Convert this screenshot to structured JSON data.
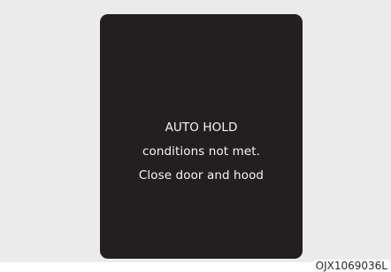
{
  "display": {
    "lines": [
      "AUTO HOLD",
      "conditions not met.",
      "Close door and hood"
    ]
  },
  "figure_code": "OJX1069036L",
  "colors": {
    "frame_background": "#ebebeb",
    "screen_background": "#231f20",
    "screen_text": "#f4f4f4"
  }
}
